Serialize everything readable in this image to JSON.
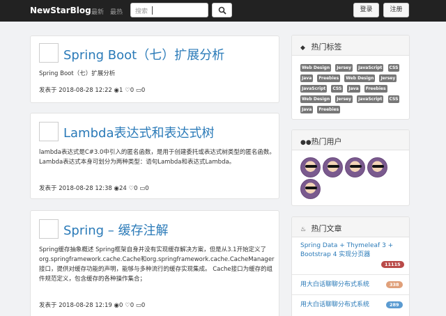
{
  "navbar": {
    "brand": "NewStarBlog",
    "links": [
      "最新",
      "最热"
    ],
    "search_placeholder": "搜索",
    "login_label": "登录",
    "register_label": "注册"
  },
  "posts": [
    {
      "title": "Spring Boot（七）扩展分析",
      "summary": "Spring Boot（七）扩展分析",
      "meta_prefix": "发表于",
      "date": "2018-08-28 12:22",
      "views": "1",
      "likes": "0",
      "comments": "0"
    },
    {
      "title": "Lambda表达式和表达式树",
      "summary": "lambda表达式是C#3.0中引入的匿名函数，是用于创建委托或表达式树类型的匿名函数。Lambda表达式本身可划分为两种类型：语句Lambda和表达式Lambda。",
      "meta_prefix": "发表于",
      "date": "2018-08-28 12:38",
      "views": "24",
      "likes": "0",
      "comments": "0"
    },
    {
      "title": "Spring – 缓存注解",
      "summary": "Spring缓存抽象概述 Spring框架自身并没有实现缓存解决方案，但是从3.1开始定义了org.springframework.cache.Cache和org.springframework.cache.CacheManager接口，提供对缓存功能的声明，能够与多种流行的缓存实现集成。 Cache接口为缓存的组件规范定义，包含缓存的各种操作集合；",
      "meta_prefix": "发表于",
      "date": "2018-08-28 12:19",
      "views": "0",
      "likes": "0",
      "comments": "0"
    }
  ],
  "sidebar": {
    "hot_tags_title": "热门标签",
    "tags": [
      "Web Design",
      "Jersey",
      "JavaScript",
      "CSS",
      "Java",
      "Freebies",
      "Web Design",
      "Jersey",
      "JavaScript",
      "CSS",
      "Java",
      "Freebies",
      "Web Design",
      "Jersey",
      "JavaScript",
      "CSS",
      "Java",
      "Freebies"
    ],
    "hot_users_title": "热门用户",
    "hot_articles_title": "热门文章",
    "articles": [
      {
        "title": "Spring Data + Thymeleaf 3 + Bootstrap 4 实现分页器",
        "count": "11115",
        "badge_color": "#b94a48"
      },
      {
        "title": "用大白话聊聊分布式系统",
        "count": "338",
        "badge_color": "#e0a07a"
      },
      {
        "title": "用大白话聊聊分布式系统",
        "count": "289",
        "badge_color": "#5b9bd1"
      }
    ]
  },
  "icons": {
    "search": "search-icon",
    "tags": "tags-icon",
    "users": "users-icon",
    "articles": "fire-icon",
    "views": "eye-icon",
    "likes": "heart-icon",
    "comments": "comment-icon"
  }
}
